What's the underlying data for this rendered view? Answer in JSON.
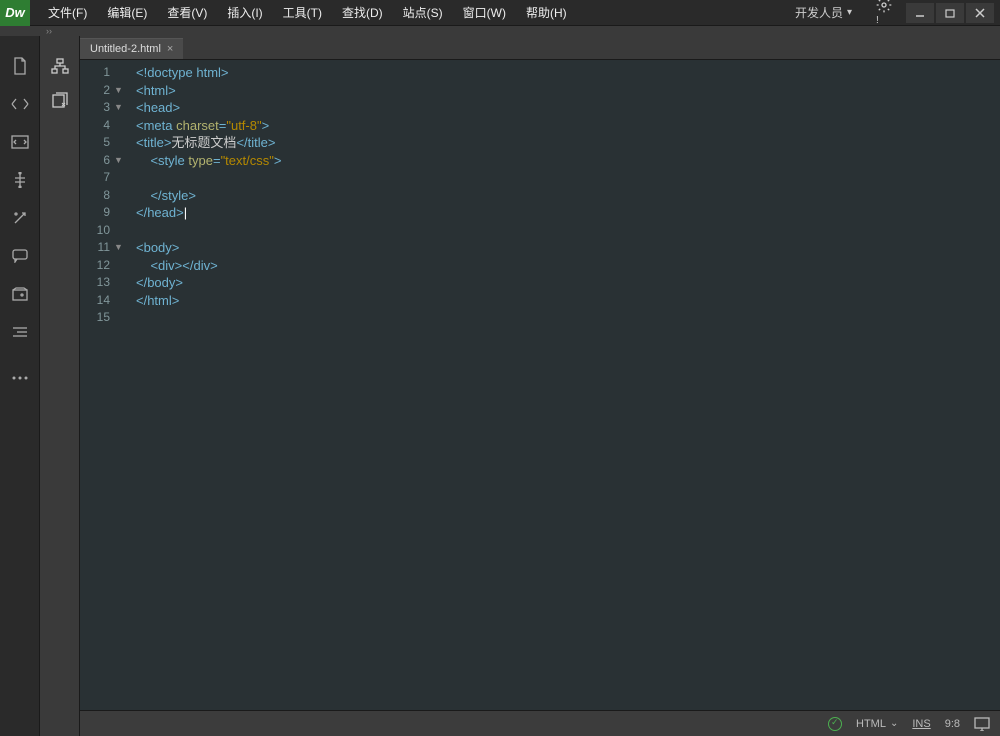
{
  "app": {
    "logo": "Dw"
  },
  "menu": [
    "文件(F)",
    "编辑(E)",
    "查看(V)",
    "插入(I)",
    "工具(T)",
    "查找(D)",
    "站点(S)",
    "窗口(W)",
    "帮助(H)"
  ],
  "titlebar": {
    "dev_label": "开发人员"
  },
  "tabs": [
    {
      "name": "Untitled-2.html"
    }
  ],
  "code": {
    "lines": [
      {
        "n": 1,
        "fold": "",
        "tokens": [
          {
            "t": "tag",
            "v": "<!doctype html>"
          }
        ]
      },
      {
        "n": 2,
        "fold": "▼",
        "tokens": [
          {
            "t": "tag",
            "v": "<html>"
          }
        ]
      },
      {
        "n": 3,
        "fold": "▼",
        "tokens": [
          {
            "t": "tag",
            "v": "<head>"
          }
        ]
      },
      {
        "n": 4,
        "fold": "",
        "tokens": [
          {
            "t": "tag",
            "v": "<meta "
          },
          {
            "t": "attr-name",
            "v": "charset"
          },
          {
            "t": "tag",
            "v": "="
          },
          {
            "t": "attr-val",
            "v": "\"utf-8\""
          },
          {
            "t": "tag",
            "v": ">"
          }
        ]
      },
      {
        "n": 5,
        "fold": "",
        "tokens": [
          {
            "t": "tag",
            "v": "<title>"
          },
          {
            "t": "txt-content",
            "v": "无标题文档"
          },
          {
            "t": "tag",
            "v": "</title>"
          }
        ]
      },
      {
        "n": 6,
        "fold": "▼",
        "tokens": [
          {
            "t": "txt-content",
            "v": "    "
          },
          {
            "t": "tag",
            "v": "<style "
          },
          {
            "t": "attr-name",
            "v": "type"
          },
          {
            "t": "tag",
            "v": "="
          },
          {
            "t": "attr-val",
            "v": "\"text/css\""
          },
          {
            "t": "tag",
            "v": ">"
          }
        ]
      },
      {
        "n": 7,
        "fold": "",
        "tokens": []
      },
      {
        "n": 8,
        "fold": "",
        "tokens": [
          {
            "t": "txt-content",
            "v": "    "
          },
          {
            "t": "tag",
            "v": "</style>"
          }
        ]
      },
      {
        "n": 9,
        "fold": "",
        "tokens": [
          {
            "t": "tag",
            "v": "</head>"
          }
        ],
        "cursor": true
      },
      {
        "n": 10,
        "fold": "",
        "tokens": []
      },
      {
        "n": 11,
        "fold": "▼",
        "tokens": [
          {
            "t": "tag",
            "v": "<body>"
          }
        ]
      },
      {
        "n": 12,
        "fold": "",
        "tokens": [
          {
            "t": "txt-content",
            "v": "    "
          },
          {
            "t": "tag",
            "v": "<div></div>"
          }
        ]
      },
      {
        "n": 13,
        "fold": "",
        "tokens": [
          {
            "t": "tag",
            "v": "</body>"
          }
        ]
      },
      {
        "n": 14,
        "fold": "",
        "tokens": [
          {
            "t": "tag",
            "v": "</html>"
          }
        ]
      },
      {
        "n": 15,
        "fold": "",
        "tokens": []
      }
    ]
  },
  "status": {
    "lang": "HTML",
    "ins": "INS",
    "pos": "9:8"
  }
}
